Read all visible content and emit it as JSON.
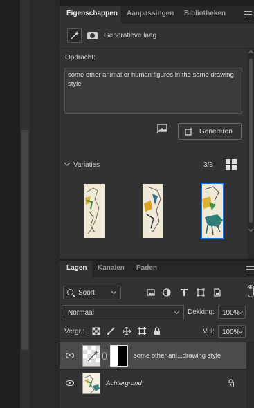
{
  "properties_panel": {
    "tabs": [
      {
        "label": "Eigenschappen",
        "active": true
      },
      {
        "label": "Aanpassingen",
        "active": false
      },
      {
        "label": "Bibliotheken",
        "active": false
      }
    ],
    "layer_type_label": "Generatieve laag",
    "prompt_label": "Opdracht:",
    "prompt_text": "some other animal or human figures in the same drawing style",
    "generate_label": "Genereren",
    "variations_label": "Variaties",
    "variations_count": "3/3",
    "selected_variation": 3
  },
  "layers_panel": {
    "tabs": [
      {
        "label": "Lagen",
        "active": true
      },
      {
        "label": "Kanalen",
        "active": false
      },
      {
        "label": "Paden",
        "active": false
      }
    ],
    "filter_label": "Soort",
    "blend_mode": "Normaal",
    "opacity_label": "Dekking:",
    "opacity_value": "100%",
    "lock_label": "Vergr.:",
    "fill_label": "Vul:",
    "fill_value": "100%",
    "layers": [
      {
        "name": "some other ani...drawing style",
        "selected": true,
        "visible": true,
        "locked": false
      },
      {
        "name": "Achtergrond",
        "selected": false,
        "visible": true,
        "locked": true
      }
    ]
  },
  "colors": {
    "accent": "#1473e6",
    "panel_bg": "#323232",
    "tab_bar_bg": "#262626",
    "selected_row_bg": "#4b4b4b"
  },
  "icons": [
    "wand-icon",
    "mask-icon",
    "image-icon",
    "generate-icon",
    "grid-view-icon",
    "search-icon",
    "pixel-filter-icon",
    "adjustment-filter-icon",
    "type-filter-icon",
    "shape-filter-icon",
    "smart-object-filter-icon",
    "lock-transparent-icon",
    "lock-paint-icon",
    "lock-move-icon",
    "lock-artboard-icon",
    "lock-all-icon",
    "eye-icon",
    "link-icon",
    "lock-icon",
    "panel-menu-icon"
  ]
}
